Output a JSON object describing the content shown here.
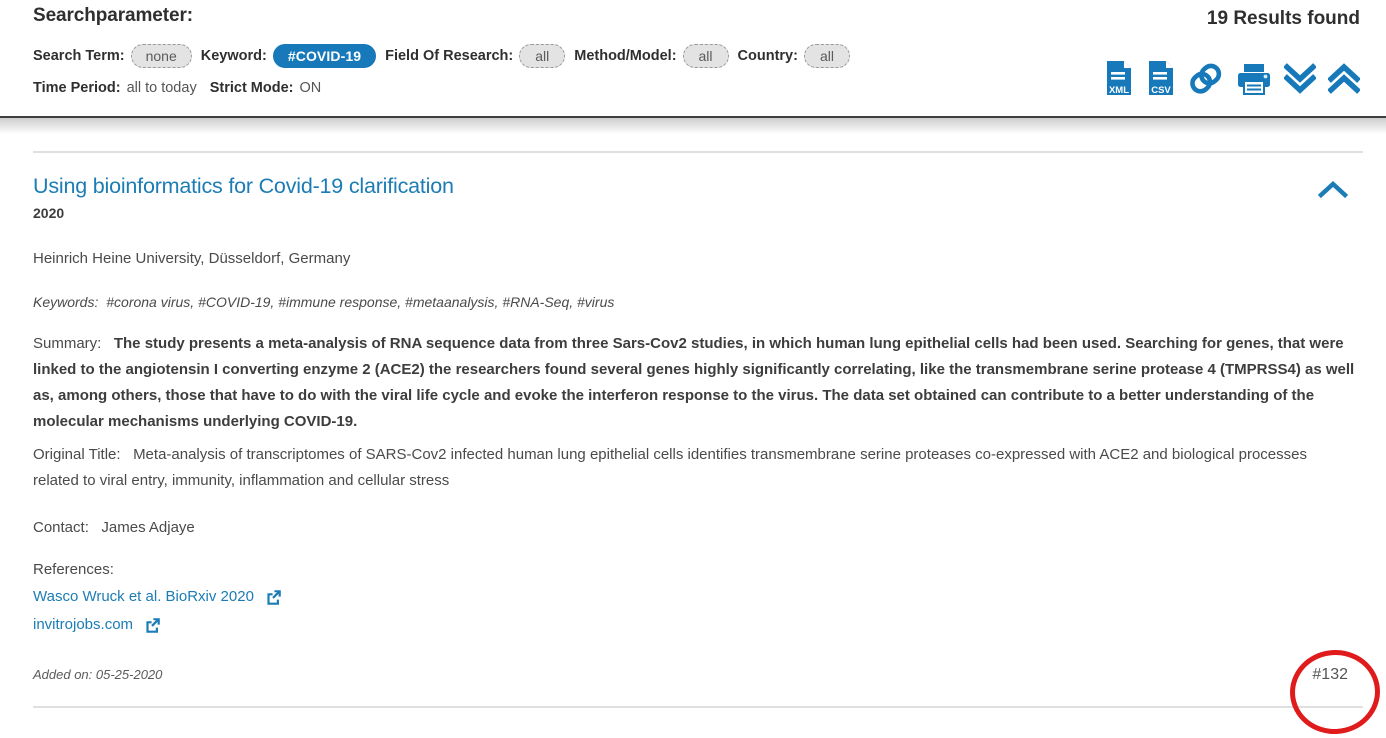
{
  "search_header": {
    "title": "Searchparameter:",
    "results_found": "19 Results found",
    "fields": {
      "search_term_label": "Search Term:",
      "search_term_value": "none",
      "keyword_label": "Keyword:",
      "keyword_value": "#COVID-19",
      "field_of_research_label": "Field Of Research:",
      "field_of_research_value": "all",
      "method_model_label": "Method/Model:",
      "method_model_value": "all",
      "country_label": "Country:",
      "country_value": "all",
      "time_period_label": "Time Period:",
      "time_period_value": "all to today",
      "strict_mode_label": "Strict Mode:",
      "strict_mode_value": "ON"
    },
    "toolbar": [
      {
        "name": "export-xml-button",
        "icon": "xml-file-icon",
        "label": "XML"
      },
      {
        "name": "export-csv-button",
        "icon": "csv-file-icon",
        "label": "CSV"
      },
      {
        "name": "copy-link-button",
        "icon": "link-chain-icon",
        "label": ""
      },
      {
        "name": "print-button",
        "icon": "printer-icon",
        "label": ""
      },
      {
        "name": "expand-all-button",
        "icon": "double-chevron-down-icon",
        "label": ""
      },
      {
        "name": "collapse-all-button",
        "icon": "double-chevron-up-icon",
        "label": ""
      }
    ],
    "accent_color": "#1779ba",
    "chip_inactive_color": "#e3e3e3"
  },
  "result": {
    "title": "Using bioinformatics for Covid-19 clarification",
    "year": "2020",
    "affiliation": "Heinrich Heine University, Düsseldorf, Germany",
    "keywords_label": "Keywords:",
    "keywords_value": "#corona virus, #COVID-19, #immune response, #metaanalysis, #RNA-Seq, #virus",
    "summary_label": "Summary:",
    "summary_text": "The study presents a meta-analysis of RNA sequence data from three Sars-Cov2 studies, in which human lung epithelial cells had been used. Searching for genes, that were linked to the angiotensin I converting enzyme 2 (ACE2) the researchers found several genes highly significantly correlating, like the transmembrane serine protease 4 (TMPRSS4) as well as, among others, those that have to do with the viral life cycle and evoke the interferon response to the virus. The data set obtained can contribute to a better understanding of the molecular mechanisms underlying COVID-19.",
    "original_title_label": "Original Title:",
    "original_title_text": "Meta-analysis of transcriptomes of SARS-Cov2 infected human lung epithelial cells identifies transmembrane serine proteases co-expressed with ACE2 and biological processes related to viral entry, immunity, inflammation and cellular stress",
    "contact_label": "Contact:",
    "contact_value": "James Adjaye",
    "references_label": "References:",
    "references": [
      {
        "text": "Wasco Wruck et al. BioRxiv 2020"
      },
      {
        "text": "invitrojobs.com"
      }
    ],
    "added_on": "Added on: 05-25-2020",
    "entry_id": "#132",
    "collapse_icon": "chevron-up-icon",
    "link_color": "#1c7cb5"
  },
  "annotation": {
    "shape": "ellipse",
    "color": "#e01b1b",
    "targets": "entry-id"
  }
}
